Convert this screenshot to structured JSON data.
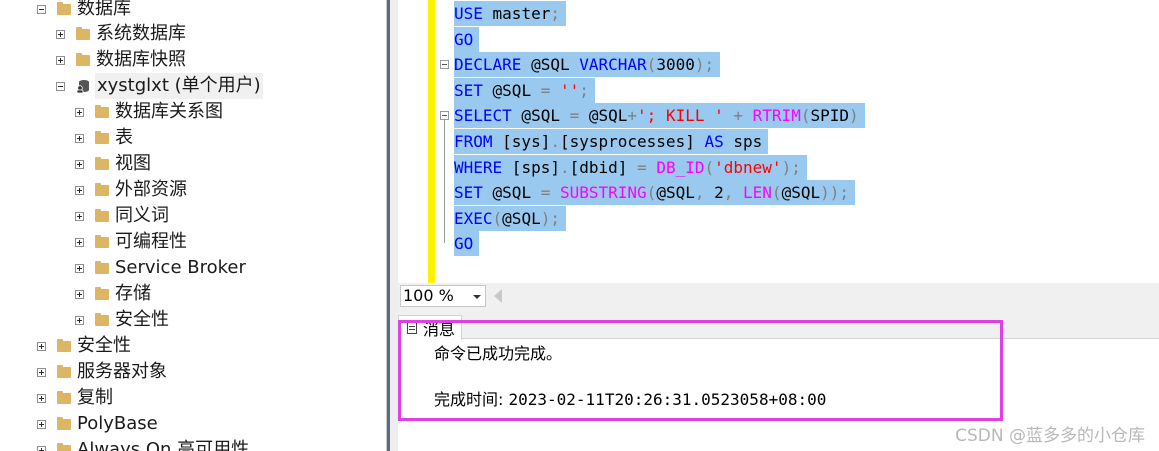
{
  "tree": {
    "nodes": [
      {
        "label": "数据库",
        "expander": "minus",
        "icon": "folder"
      },
      {
        "label": "系统数据库",
        "expander": "plus",
        "icon": "folder"
      },
      {
        "label": "数据库快照",
        "expander": "plus",
        "icon": "folder"
      },
      {
        "label": "xystglxt (单个用户)",
        "expander": "minus",
        "icon": "database-user"
      },
      {
        "label": "数据库关系图",
        "expander": "plus",
        "icon": "folder"
      },
      {
        "label": "表",
        "expander": "plus",
        "icon": "folder"
      },
      {
        "label": "视图",
        "expander": "plus",
        "icon": "folder"
      },
      {
        "label": "外部资源",
        "expander": "plus",
        "icon": "folder"
      },
      {
        "label": "同义词",
        "expander": "plus",
        "icon": "folder"
      },
      {
        "label": "可编程性",
        "expander": "plus",
        "icon": "folder"
      },
      {
        "label": "Service Broker",
        "expander": "plus",
        "icon": "folder"
      },
      {
        "label": "存储",
        "expander": "plus",
        "icon": "folder"
      },
      {
        "label": "安全性",
        "expander": "plus",
        "icon": "folder"
      },
      {
        "label": "安全性",
        "expander": "plus",
        "icon": "folder"
      },
      {
        "label": "服务器对象",
        "expander": "plus",
        "icon": "folder"
      },
      {
        "label": "复制",
        "expander": "plus",
        "icon": "folder"
      },
      {
        "label": "PolyBase",
        "expander": "plus",
        "icon": "folder"
      },
      {
        "label": "Always On 高可用性",
        "expander": "plus",
        "icon": "folder"
      }
    ]
  },
  "editor": {
    "lines": [
      [
        {
          "t": "USE",
          "c": "kw"
        },
        {
          "t": " master",
          "c": "tx"
        },
        {
          "t": ";",
          "c": "op"
        }
      ],
      [
        {
          "t": "GO",
          "c": "kw"
        }
      ],
      [
        {
          "t": "DECLARE",
          "c": "kw"
        },
        {
          "t": " @SQL ",
          "c": "tx"
        },
        {
          "t": "VARCHAR",
          "c": "kw"
        },
        {
          "t": "(",
          "c": "op"
        },
        {
          "t": "3000",
          "c": "tx"
        },
        {
          "t": ");",
          "c": "op"
        }
      ],
      [
        {
          "t": "SET",
          "c": "kw"
        },
        {
          "t": " @SQL ",
          "c": "tx"
        },
        {
          "t": "=",
          "c": "op"
        },
        {
          "t": " ''",
          "c": "str"
        },
        {
          "t": ";",
          "c": "op"
        }
      ],
      [
        {
          "t": "SELECT",
          "c": "kw"
        },
        {
          "t": " @SQL ",
          "c": "tx"
        },
        {
          "t": "=",
          "c": "op"
        },
        {
          "t": " @SQL",
          "c": "tx"
        },
        {
          "t": "+",
          "c": "op"
        },
        {
          "t": "'; KILL '",
          "c": "str"
        },
        {
          "t": " + ",
          "c": "op"
        },
        {
          "t": "RTRIM",
          "c": "fn"
        },
        {
          "t": "(",
          "c": "op"
        },
        {
          "t": "SPID",
          "c": "tx"
        },
        {
          "t": ")",
          "c": "op"
        }
      ],
      [
        {
          "t": "FROM",
          "c": "kw"
        },
        {
          "t": " [sys]",
          "c": "tx"
        },
        {
          "t": ".",
          "c": "op"
        },
        {
          "t": "[sysprocesses]",
          "c": "tx"
        },
        {
          "t": " AS",
          "c": "kw"
        },
        {
          "t": " sps",
          "c": "tx"
        }
      ],
      [
        {
          "t": "WHERE",
          "c": "kw"
        },
        {
          "t": " [sps]",
          "c": "tx"
        },
        {
          "t": ".",
          "c": "op"
        },
        {
          "t": "[dbid] ",
          "c": "tx"
        },
        {
          "t": "=",
          "c": "op"
        },
        {
          "t": " DB_ID",
          "c": "fn"
        },
        {
          "t": "(",
          "c": "op"
        },
        {
          "t": "'dbnew'",
          "c": "str"
        },
        {
          "t": ");",
          "c": "op"
        }
      ],
      [
        {
          "t": "SET",
          "c": "kw"
        },
        {
          "t": " @SQL ",
          "c": "tx"
        },
        {
          "t": "=",
          "c": "op"
        },
        {
          "t": " SUBSTRING",
          "c": "fn"
        },
        {
          "t": "(",
          "c": "op"
        },
        {
          "t": "@SQL",
          "c": "tx"
        },
        {
          "t": ",",
          "c": "op"
        },
        {
          "t": " 2",
          "c": "tx"
        },
        {
          "t": ",",
          "c": "op"
        },
        {
          "t": " LEN",
          "c": "fn"
        },
        {
          "t": "(",
          "c": "op"
        },
        {
          "t": "@SQL",
          "c": "tx"
        },
        {
          "t": "));",
          "c": "op"
        }
      ],
      [
        {
          "t": "EXEC",
          "c": "kw"
        },
        {
          "t": "(",
          "c": "op"
        },
        {
          "t": "@SQL",
          "c": "tx"
        },
        {
          "t": ");",
          "c": "op"
        }
      ],
      [
        {
          "t": "GO",
          "c": "kw"
        }
      ]
    ],
    "colors": {
      "keyword": "#0000ff",
      "function": "#ff00ff",
      "string": "#ff0000",
      "operator": "#808080",
      "selection": "#99c9ef",
      "change_bar": "#fff200"
    }
  },
  "zoom": {
    "value": "100 %"
  },
  "results": {
    "tab_label": "消息",
    "line1": "命令已成功完成。",
    "line2_label": "完成时间: ",
    "line2_value": "2023-02-11T20:26:31.0523058+08:00"
  },
  "watermark": "CSDN @蓝多多的小仓库",
  "highlight_color": "#e040e0"
}
